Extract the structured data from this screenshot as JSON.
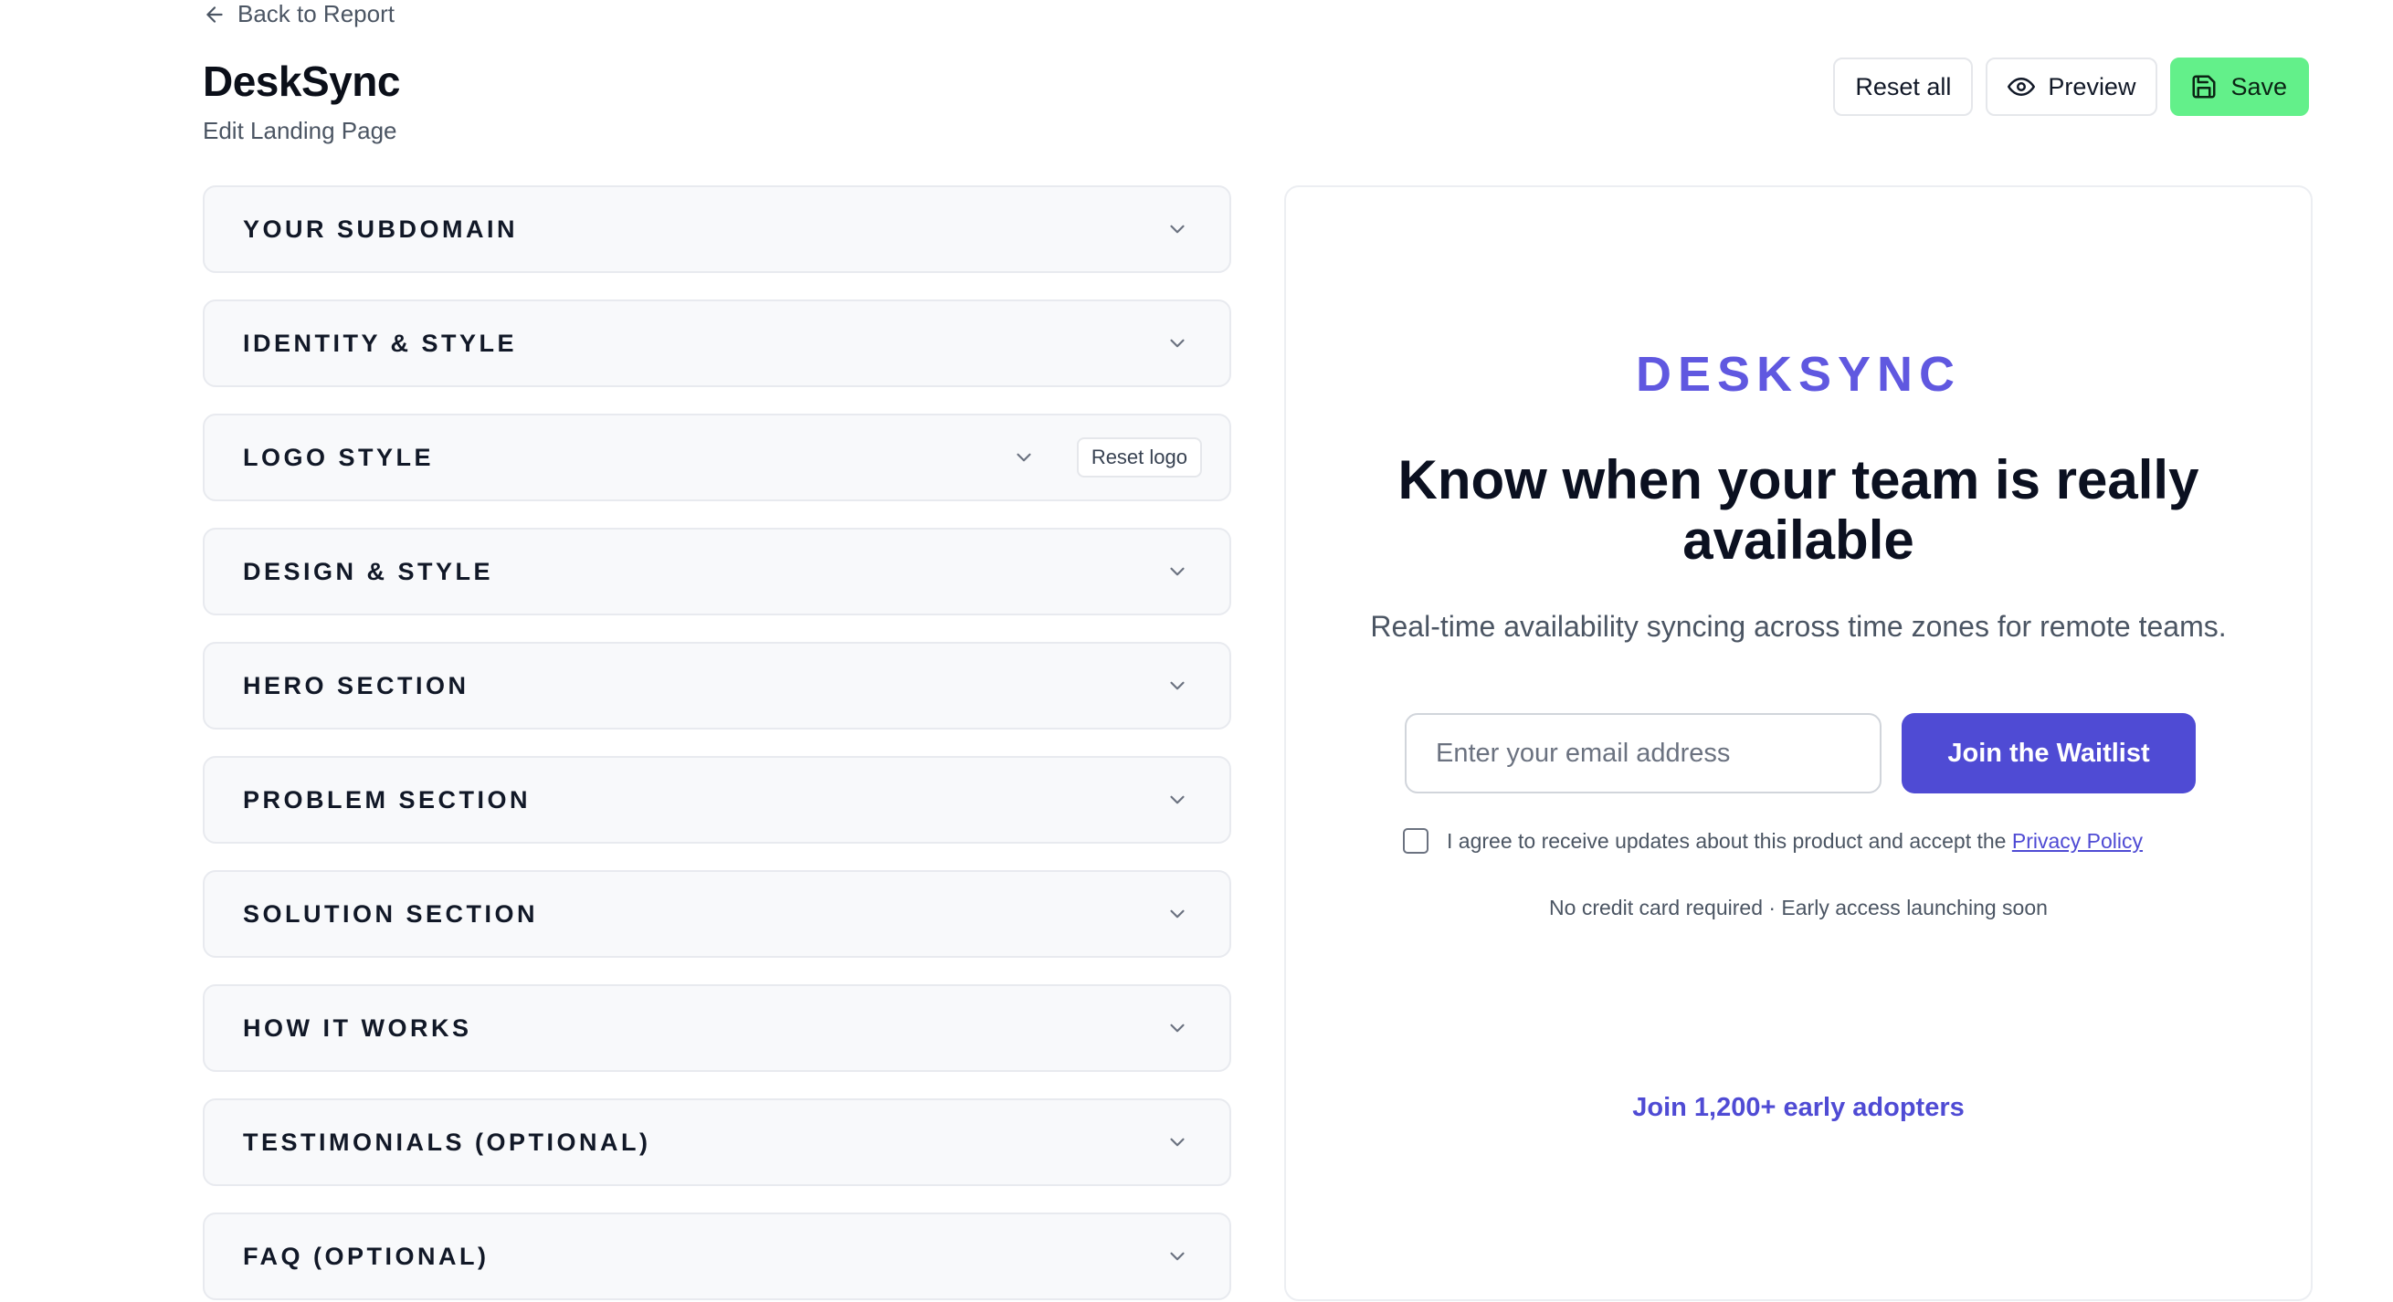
{
  "header": {
    "back_label": "Back to Report",
    "title": "DeskSync",
    "subtitle": "Edit Landing Page",
    "actions": {
      "reset_all": "Reset all",
      "preview": "Preview",
      "save": "Save"
    }
  },
  "sections": [
    {
      "label": "YOUR SUBDOMAIN"
    },
    {
      "label": "IDENTITY & STYLE"
    },
    {
      "label": "LOGO STYLE",
      "extra_button": "Reset logo"
    },
    {
      "label": "DESIGN & STYLE"
    },
    {
      "label": "HERO SECTION"
    },
    {
      "label": "PROBLEM SECTION"
    },
    {
      "label": "SOLUTION SECTION"
    },
    {
      "label": "HOW IT WORKS"
    },
    {
      "label": "TESTIMONIALS (OPTIONAL)"
    },
    {
      "label": "FAQ (OPTIONAL)"
    }
  ],
  "preview": {
    "brand": "DESKSYNC",
    "headline": "Know when your team is really available",
    "tagline": "Real-time availability syncing across time zones for remote teams.",
    "email_placeholder": "Enter your email address",
    "cta_label": "Join the Waitlist",
    "consent_text": "I agree to receive updates about this product and accept the",
    "privacy_link": "Privacy Policy",
    "consent_checked": false,
    "footnote": "No credit card required · Early access launching soon",
    "social_proof": "Join 1,200+ early adopters"
  },
  "colors": {
    "accent": "#4f4bd4",
    "brand": "#6058e0",
    "save": "#63f08a"
  },
  "icons": {
    "back": "arrow-left-icon",
    "preview": "eye-icon",
    "save": "floppy-disk-icon",
    "section_toggle": "chevron-down-icon"
  }
}
